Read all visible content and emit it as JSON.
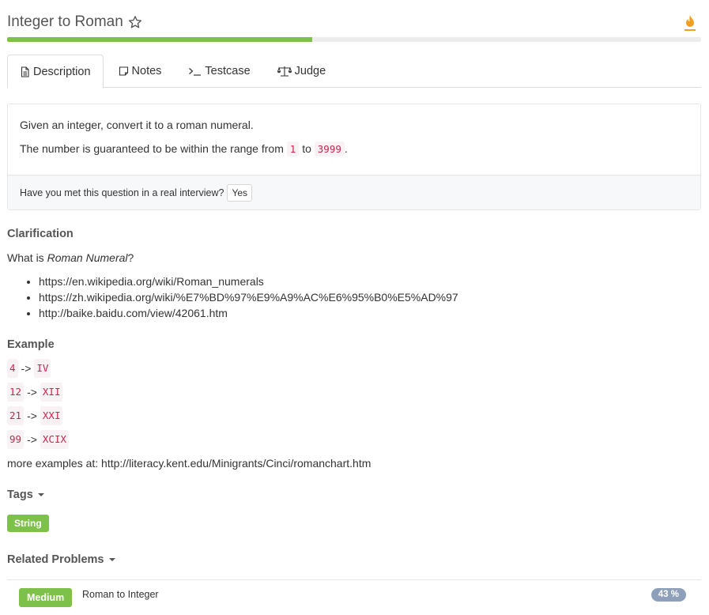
{
  "header": {
    "title": "Integer to Roman",
    "star_icon": "star-outline-icon",
    "fire_icon": "flame-icon",
    "accent_color": "#f0a020"
  },
  "progress": {
    "fraction": 0.44,
    "color": "#7dc14b"
  },
  "tabs": [
    {
      "label": "Description",
      "icon": "document-icon",
      "active": true
    },
    {
      "label": "Notes",
      "icon": "note-icon",
      "active": false
    },
    {
      "label": "Testcase",
      "icon": "terminal-icon",
      "active": false
    },
    {
      "label": "Judge",
      "icon": "scales-icon",
      "active": false
    }
  ],
  "description": {
    "line1": "Given an integer, convert it to a roman numeral.",
    "line2_prefix": "The number is guaranteed to be within the range from",
    "range_min": "1",
    "range_joiner": "to",
    "range_max": "3999",
    "line2_suffix": ".",
    "footer_question": "Have you met this question in a real interview?",
    "yes_label": "Yes"
  },
  "clarification": {
    "heading": "Clarification",
    "question_prefix": "What is",
    "question_term": "Roman Numeral",
    "question_suffix": "?",
    "links": [
      "https://en.wikipedia.org/wiki/Roman_numerals",
      "https://zh.wikipedia.org/wiki/%E7%BD%97%E9%A9%AC%E6%95%B0%E5%AD%97",
      "http://baike.baidu.com/view/42061.htm"
    ]
  },
  "example": {
    "heading": "Example",
    "arrow": "->",
    "rows": [
      {
        "input": "4",
        "output": "IV"
      },
      {
        "input": "12",
        "output": "XII"
      },
      {
        "input": "21",
        "output": "XXI"
      },
      {
        "input": "99",
        "output": "XCIX"
      }
    ],
    "more": "more examples at: http://literacy.kent.edu/Minigrants/Cinci/romanchart.htm"
  },
  "tags": {
    "heading": "Tags",
    "items": [
      "String"
    ]
  },
  "related": {
    "heading": "Related Problems",
    "items": [
      {
        "difficulty": "Medium",
        "title": "Roman to Integer",
        "percent": "43 %"
      }
    ]
  }
}
